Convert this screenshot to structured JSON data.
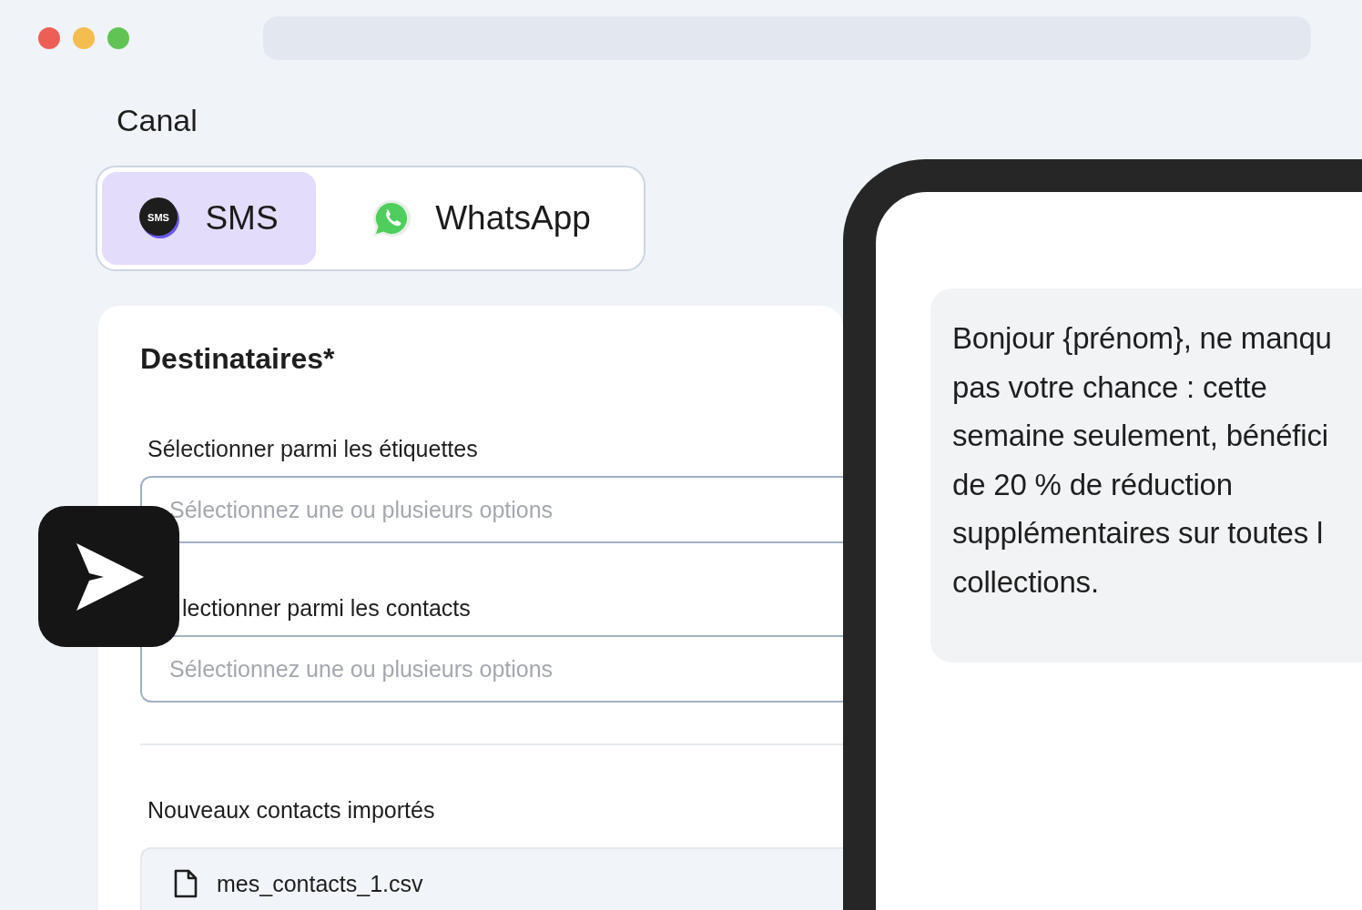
{
  "window": {
    "traffic_lights": [
      {
        "color": "#ec5f57"
      },
      {
        "color": "#f4bd4f"
      },
      {
        "color": "#5fc453"
      }
    ]
  },
  "channel": {
    "title": "Canal",
    "options": [
      {
        "kind": "sms",
        "label": "SMS",
        "icon_text": "SMS",
        "selected": true
      },
      {
        "kind": "whatsapp",
        "label": "WhatsApp",
        "selected": false
      }
    ]
  },
  "recipients": {
    "title": "Destinataires*",
    "fields": [
      {
        "label": "Sélectionner parmi les étiquettes",
        "placeholder": "Sélectionnez une ou plusieurs options"
      },
      {
        "label": "lectionner parmi les contacts",
        "placeholder": "Sélectionnez une ou plusieurs options"
      }
    ],
    "imports": {
      "label": "Nouveaux contacts importés",
      "files": [
        "mes_contacts_1.csv"
      ]
    }
  },
  "preview": {
    "message_lines": [
      "Bonjour {prénom}, ne manqu",
      "pas votre chance : cette",
      "semaine seulement, bénéfici",
      "de 20 % de réduction",
      "supplémentaires sur toutes l",
      "collections."
    ]
  }
}
